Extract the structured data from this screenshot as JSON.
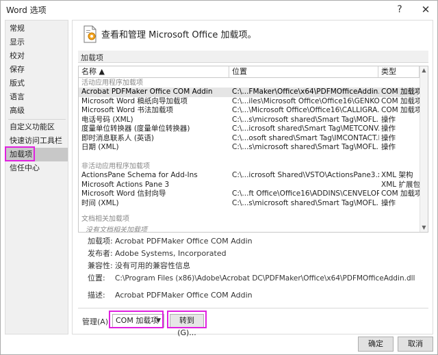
{
  "window": {
    "title": "Word 选项",
    "help_label": "?",
    "close_label": "✕"
  },
  "sidebar": {
    "items": [
      {
        "label": "常规"
      },
      {
        "label": "显示"
      },
      {
        "label": "校对"
      },
      {
        "label": "保存"
      },
      {
        "label": "版式"
      },
      {
        "label": "语言"
      },
      {
        "label": "高级"
      },
      {
        "label": "自定义功能区"
      },
      {
        "label": "快速访问工具栏"
      },
      {
        "label": "加载项",
        "selected": true
      },
      {
        "label": "信任中心"
      }
    ]
  },
  "main": {
    "header_title": "查看和管理 Microsoft Office 加载项。",
    "header_icon": "addin-gear-icon",
    "section_label": "加载项",
    "columns": [
      "名称 ▲",
      "位置",
      "类型"
    ],
    "groups": [
      {
        "title": "活动应用程序加载项",
        "rows": [
          [
            "Acrobat PDFMaker Office COM Addin",
            "C:\\...FMaker\\Office\\x64\\PDFMOfficeAddin.dll",
            "COM 加载项"
          ],
          [
            "Microsoft Word 稿纸向导加载项",
            "C:\\...iles\\Microsoft Office\\Office16\\GENKO.DLL",
            "COM 加载项"
          ],
          [
            "Microsoft Word 书法加载项",
            "C:\\...\\Microsoft Office\\Office16\\CALLIGRA.DLL",
            "COM 加载项"
          ],
          [
            "电话号码 (XML)",
            "C:\\...s\\microsoft shared\\Smart Tag\\MOFL.DLL",
            "操作"
          ],
          [
            "度量单位转换器 (度量单位转换器)",
            "C:\\...icrosoft shared\\Smart Tag\\METCONV.DLL",
            "操作"
          ],
          [
            "即时消息联系人 (英语)",
            "C:\\...osoft shared\\Smart Tag\\IMCONTACT.DLL",
            "操作"
          ],
          [
            "日期 (XML)",
            "C:\\...s\\microsoft shared\\Smart Tag\\MOFL.DLL",
            "操作"
          ]
        ]
      },
      {
        "title": "非活动应用程序加载项",
        "rows": [
          [
            "ActionsPane Schema for Add-Ins",
            "C:\\...icrosoft Shared\\VSTO\\ActionsPane3.xsd",
            "XML 架构"
          ],
          [
            "Microsoft Actions Pane 3",
            "",
            "XML 扩展包"
          ],
          [
            "Microsoft Word 信封向导",
            "C:\\...ft Office\\Office16\\ADDINS\\CENVELOP.DLL",
            "COM 加载项"
          ],
          [
            "时间 (XML)",
            "C:\\...s\\microsoft shared\\Smart Tag\\MOFL.DLL",
            "操作"
          ]
        ]
      },
      {
        "title": "文档相关加载项",
        "empty_text": "没有文档相关加载项",
        "rows": []
      }
    ],
    "details": [
      {
        "label": "加载项:",
        "value": "Acrobat PDFMaker Office COM Addin"
      },
      {
        "label": "发布者:",
        "value": "Adobe Systems, Incorporated"
      },
      {
        "label": "兼容性:",
        "value": "没有可用的兼容性信息"
      },
      {
        "label": "位置:",
        "value": "C:\\Program Files (x86)\\Adobe\\Acrobat DC\\PDFMaker\\Office\\x64\\PDFMOfficeAddin.dll"
      },
      {
        "label": "描述:",
        "value": "Acrobat PDFMaker Office COM Addin"
      }
    ],
    "manage_label": "管理(A):",
    "manage_value": "COM 加载项",
    "goto_label": "转到(G)..."
  },
  "footer": {
    "ok_label": "确定",
    "cancel_label": "取消"
  },
  "colors": {
    "highlight": "#e020e0",
    "selected_nav": "#c8c8c8",
    "selected_row": "#e5e5e5"
  }
}
